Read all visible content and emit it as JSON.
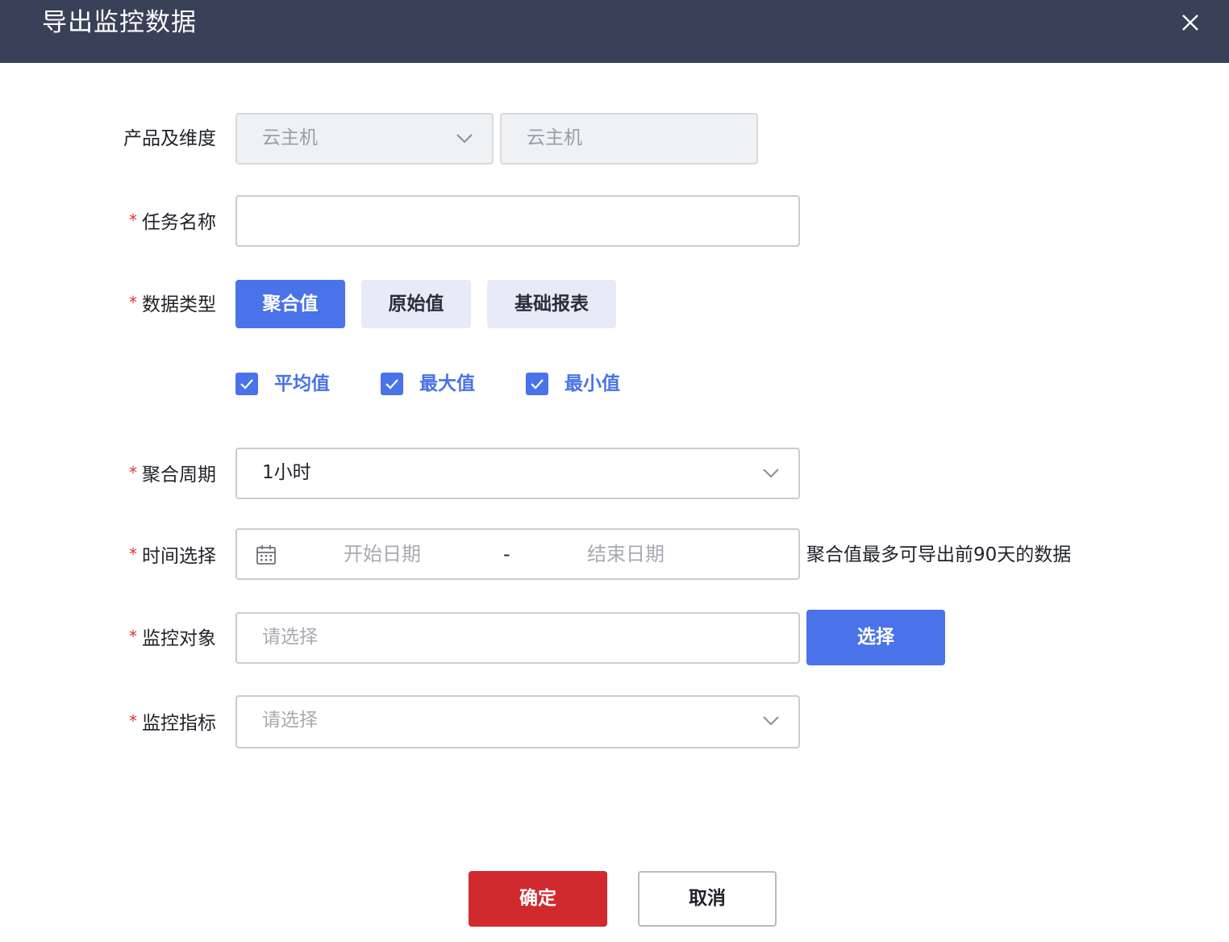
{
  "dialog": {
    "title": "导出监控数据"
  },
  "form": {
    "product": {
      "label": "产品及维度",
      "product_value": "云主机",
      "dimension_value": "云主机"
    },
    "task_name": {
      "label": "任务名称",
      "value": ""
    },
    "data_type": {
      "label": "数据类型",
      "options": [
        "聚合值",
        "原始值",
        "基础报表"
      ],
      "selected": "聚合值",
      "checkboxes": [
        {
          "label": "平均值",
          "checked": true
        },
        {
          "label": "最大值",
          "checked": true
        },
        {
          "label": "最小值",
          "checked": true
        }
      ]
    },
    "period": {
      "label": "聚合周期",
      "value": "1小时"
    },
    "time_range": {
      "label": "时间选择",
      "start_placeholder": "开始日期",
      "separator": "-",
      "end_placeholder": "结束日期",
      "note": "聚合值最多可导出前90天的数据"
    },
    "monitor_object": {
      "label": "监控对象",
      "placeholder": "请选择",
      "select_button": "选择"
    },
    "monitor_metric": {
      "label": "监控指标",
      "placeholder": "请选择"
    },
    "required_mark": "*"
  },
  "footer": {
    "confirm_label": "确定",
    "cancel_label": "取消"
  },
  "colors": {
    "header_bg": "#384157",
    "primary": "#4a72e9",
    "confirm": "#d0292e",
    "required": "#e0322e"
  }
}
